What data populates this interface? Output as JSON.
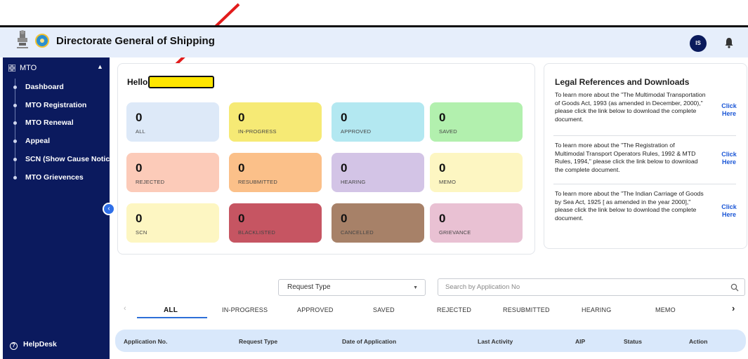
{
  "header": {
    "title": "Directorate General of Shipping",
    "avatar_initials": "IS"
  },
  "sidebar": {
    "menu_label": "MTO",
    "items": [
      {
        "label": "Dashboard"
      },
      {
        "label": "MTO Registration"
      },
      {
        "label": "MTO Renewal"
      },
      {
        "label": "Appeal"
      },
      {
        "label": "SCN (Show Cause Notice)"
      },
      {
        "label": "MTO Grievences"
      }
    ],
    "helpdesk_label": "HelpDesk"
  },
  "greeting": {
    "hello": "Hello"
  },
  "stats": [
    {
      "value": "0",
      "label": "ALL",
      "color": "#dde9f8"
    },
    {
      "value": "0",
      "label": "IN-PROGRESS",
      "color": "#f6ea75"
    },
    {
      "value": "0",
      "label": "APPROVED",
      "color": "#b3e8f1"
    },
    {
      "value": "0",
      "label": "SAVED",
      "color": "#b2f0ae"
    },
    {
      "value": "0",
      "label": "REJECTED",
      "color": "#fccbb9"
    },
    {
      "value": "0",
      "label": "RESUBMITTED",
      "color": "#fbc089"
    },
    {
      "value": "0",
      "label": "HEARING",
      "color": "#d3c4e6"
    },
    {
      "value": "0",
      "label": "MEMO",
      "color": "#fdf6c2"
    },
    {
      "value": "0",
      "label": "SCN",
      "color": "#fdf6c2"
    },
    {
      "value": "0",
      "label": "BLACKLISTED",
      "color": "#c65562"
    },
    {
      "value": "0",
      "label": "CANCELLED",
      "color": "#a78168"
    },
    {
      "value": "0",
      "label": "GRIEVANCE",
      "color": "#e9c1d3"
    }
  ],
  "legal": {
    "title": "Legal References and Downloads",
    "refs": [
      {
        "lines": [
          "To learn more about the \"The Multimodal Transportation",
          "of Goods Act, 1993 (as amended in December, 2000),\"",
          "please click the link below to download the complete",
          "document."
        ],
        "link": [
          "Click",
          "Here"
        ]
      },
      {
        "lines": [
          "To learn more about the \"The Registration of",
          "Multimodal Transport Operators Rules, 1992 & MTD",
          "Rules, 1994,\" please click the link below to download",
          "the complete document."
        ],
        "link": [
          "Click",
          "Here"
        ]
      },
      {
        "lines": [
          "To learn more about the \"The Indian Carriage of Goods",
          "by Sea Act, 1925 [ as amended in the year 2000],\"",
          "please click the link below to download the complete",
          "document."
        ],
        "link": [
          "Click",
          "Here"
        ]
      }
    ]
  },
  "filters": {
    "request_type_value": "Request Type",
    "search_placeholder": "Search by Application No"
  },
  "tabs": [
    {
      "label": "ALL"
    },
    {
      "label": "IN-PROGRESS"
    },
    {
      "label": "APPROVED"
    },
    {
      "label": "SAVED"
    },
    {
      "label": "REJECTED"
    },
    {
      "label": "RESUBMITTED"
    },
    {
      "label": "HEARING"
    },
    {
      "label": "MEMO"
    }
  ],
  "table": {
    "columns": [
      "Application No.",
      "Request Type",
      "Date of Application",
      "Last Activity",
      "AIP",
      "Status",
      "Action"
    ]
  },
  "colors": {
    "sidebar_bg": "#0b1a5e",
    "topbar_bg": "#e6eefb",
    "annotation_arrow": "#e21b1b",
    "link": "#1a56d6"
  },
  "icons": [
    "emblem-icon",
    "dgs-logo-icon",
    "bell-icon",
    "grid-icon",
    "chevron-up-icon",
    "chevron-left-icon",
    "help-icon",
    "chevron-down-icon",
    "search-icon",
    "chevron-right-icon"
  ]
}
